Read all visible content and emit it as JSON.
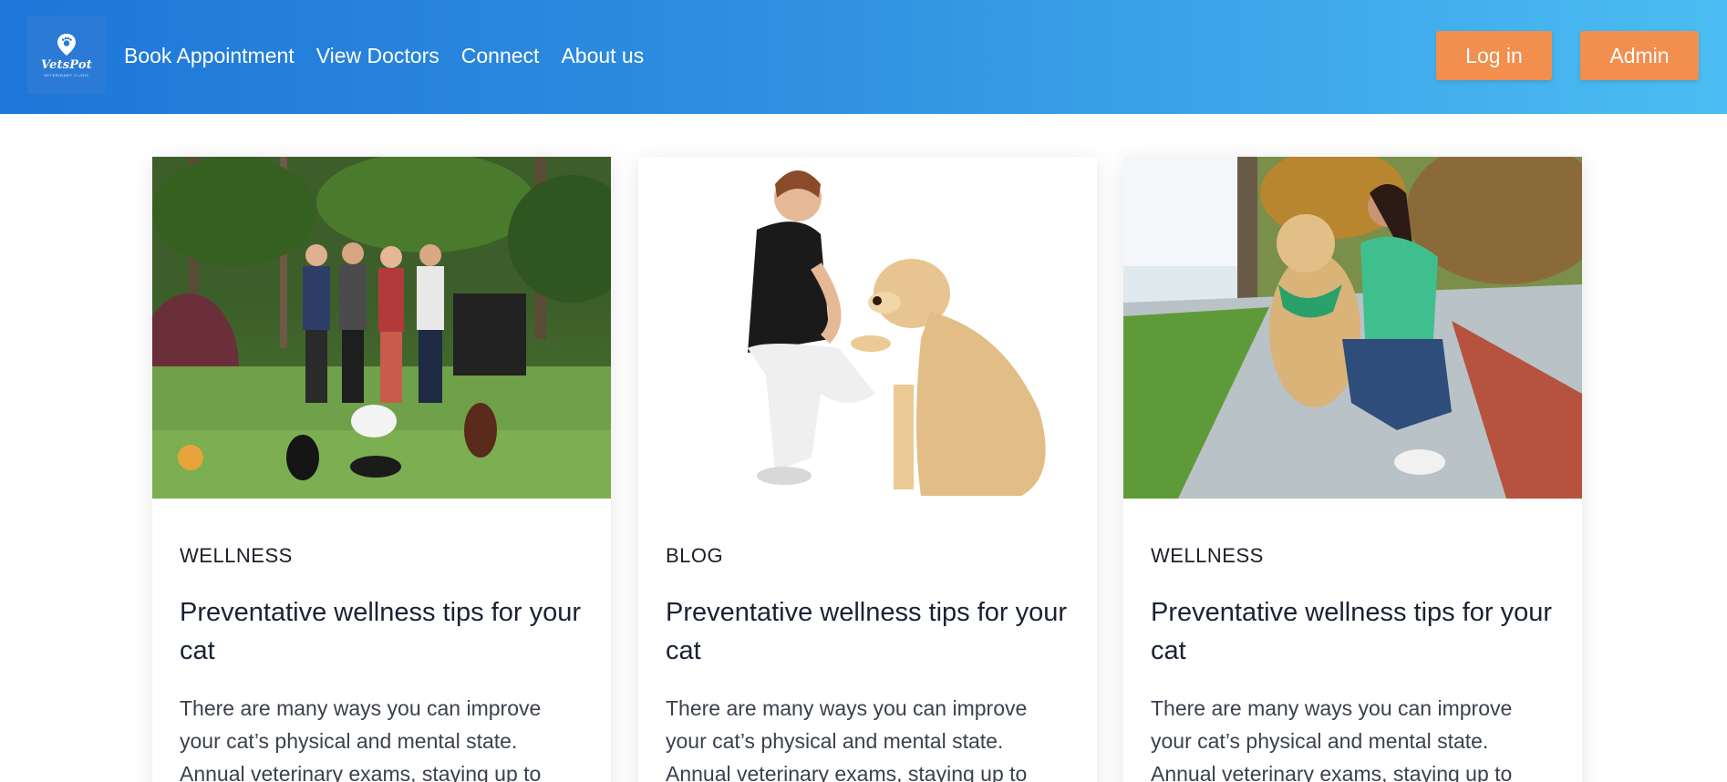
{
  "brand": {
    "name": "VetsPot",
    "tagline": "VETERINARY CLINIC"
  },
  "nav": {
    "items": [
      {
        "label": "Book Appointment"
      },
      {
        "label": "View Doctors"
      },
      {
        "label": "Connect"
      },
      {
        "label": "About us"
      }
    ]
  },
  "actions": {
    "login_label": "Log in",
    "admin_label": "Admin"
  },
  "colors": {
    "header_gradient_start": "#1e76d8",
    "header_gradient_end": "#4bbdf3",
    "button_accent": "#f28e4e"
  },
  "cards": [
    {
      "image": "group-with-dogs-photo",
      "category": "WELLNESS",
      "title": "Preventative wellness tips for your cat",
      "excerpt": "There are many ways you can improve your cat’s physical and mental state. Annual veterinary exams, staying up to"
    },
    {
      "image": "woman-with-golden-retriever-photo",
      "category": "BLOG",
      "title": "Preventative wellness tips for your cat",
      "excerpt": "There are many ways you can improve your cat’s physical and mental state. Annual veterinary exams, staying up to"
    },
    {
      "image": "woman-petting-dog-on-sidewalk-photo",
      "category": "WELLNESS",
      "title": "Preventative wellness tips for your cat",
      "excerpt": "There are many ways you can improve your cat’s physical and mental state. Annual veterinary exams, staying up to"
    }
  ]
}
